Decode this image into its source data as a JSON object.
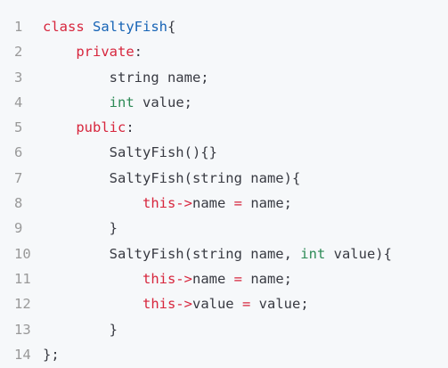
{
  "code_block": {
    "language": "cpp",
    "colors": {
      "background": "#f6f8fa",
      "line_number": "#999999",
      "keyword": "#d7263d",
      "class_name": "#1764b6",
      "type": "#2e8b57",
      "plain": "#383a42"
    },
    "lines": [
      {
        "number": "1",
        "tokens": [
          {
            "text": "class ",
            "kind": "kw"
          },
          {
            "text": "SaltyFish",
            "kind": "fn"
          },
          {
            "text": "{",
            "kind": "plain"
          }
        ]
      },
      {
        "number": "2",
        "tokens": [
          {
            "text": "    ",
            "kind": "plain"
          },
          {
            "text": "private",
            "kind": "kw"
          },
          {
            "text": ":",
            "kind": "plain"
          }
        ]
      },
      {
        "number": "3",
        "tokens": [
          {
            "text": "        string name;",
            "kind": "plain"
          }
        ]
      },
      {
        "number": "4",
        "tokens": [
          {
            "text": "        ",
            "kind": "plain"
          },
          {
            "text": "int",
            "kind": "typ"
          },
          {
            "text": " value;",
            "kind": "plain"
          }
        ]
      },
      {
        "number": "5",
        "tokens": [
          {
            "text": "    ",
            "kind": "plain"
          },
          {
            "text": "public",
            "kind": "kw"
          },
          {
            "text": ":",
            "kind": "plain"
          }
        ]
      },
      {
        "number": "6",
        "tokens": [
          {
            "text": "        SaltyFish(){}",
            "kind": "plain"
          }
        ]
      },
      {
        "number": "7",
        "tokens": [
          {
            "text": "        SaltyFish(string name){",
            "kind": "plain"
          }
        ]
      },
      {
        "number": "8",
        "tokens": [
          {
            "text": "            ",
            "kind": "plain"
          },
          {
            "text": "this->",
            "kind": "kw"
          },
          {
            "text": "name ",
            "kind": "plain"
          },
          {
            "text": "=",
            "kind": "kw"
          },
          {
            "text": " name;",
            "kind": "plain"
          }
        ]
      },
      {
        "number": "9",
        "tokens": [
          {
            "text": "        }",
            "kind": "plain"
          }
        ]
      },
      {
        "number": "10",
        "tokens": [
          {
            "text": "        SaltyFish(string name, ",
            "kind": "plain"
          },
          {
            "text": "int",
            "kind": "typ"
          },
          {
            "text": " value){",
            "kind": "plain"
          }
        ]
      },
      {
        "number": "11",
        "tokens": [
          {
            "text": "            ",
            "kind": "plain"
          },
          {
            "text": "this->",
            "kind": "kw"
          },
          {
            "text": "name ",
            "kind": "plain"
          },
          {
            "text": "=",
            "kind": "kw"
          },
          {
            "text": " name;",
            "kind": "plain"
          }
        ]
      },
      {
        "number": "12",
        "tokens": [
          {
            "text": "            ",
            "kind": "plain"
          },
          {
            "text": "this->",
            "kind": "kw"
          },
          {
            "text": "value ",
            "kind": "plain"
          },
          {
            "text": "=",
            "kind": "kw"
          },
          {
            "text": " value;",
            "kind": "plain"
          }
        ]
      },
      {
        "number": "13",
        "tokens": [
          {
            "text": "        }",
            "kind": "plain"
          }
        ]
      },
      {
        "number": "14",
        "tokens": [
          {
            "text": "};",
            "kind": "plain"
          }
        ]
      }
    ]
  }
}
